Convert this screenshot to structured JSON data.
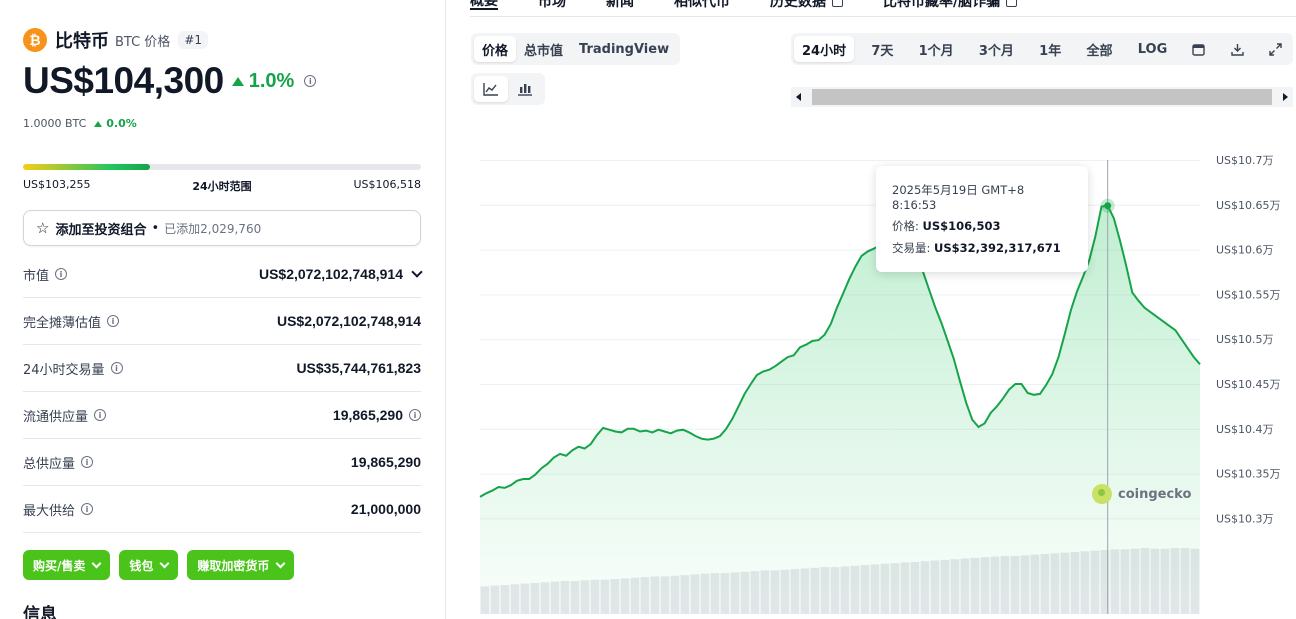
{
  "coin": {
    "logo_glyph": "₿",
    "name": "比特币",
    "subtitle": "BTC 价格",
    "rank": "#1",
    "price": "US$104,300",
    "change_24h": "1.0%",
    "price_btc": "1.0000 BTC",
    "change_btc": "0.0%",
    "colors": {
      "logo": "#f7931a",
      "up": "#16a34a",
      "action": "#4ac41a"
    }
  },
  "range": {
    "low": "US$103,255",
    "label": "24小时范围",
    "high": "US$106,518",
    "position_fraction": 0.32
  },
  "portfolio": {
    "label": "添加至投资组合",
    "separator": "•",
    "added": "已添加2,029,760"
  },
  "stats": [
    {
      "label": "市值",
      "value": "US$2,072,102,748,914"
    },
    {
      "label": "完全摊薄估值",
      "value": "US$2,072,102,748,914"
    },
    {
      "label": "24小时交易量",
      "value": "US$35,744,761,823"
    },
    {
      "label": "流通供应量",
      "value": "19,865,290"
    },
    {
      "label": "总供应量",
      "value": "19,865,290"
    },
    {
      "label": "最大供给",
      "value": "21,000,000"
    }
  ],
  "actions": [
    "购买/售卖",
    "钱包",
    "赚取加密货币"
  ],
  "info_heading": "信息",
  "top_tabs": [
    "概要",
    "市场",
    "新闻",
    "相似代币",
    "历史数据",
    "比特币藏率/脑诈骗"
  ],
  "chart_toolbar": {
    "modes": [
      "价格",
      "总市值",
      "TradingView"
    ],
    "ranges": [
      "24小时",
      "7天",
      "1个月",
      "3个月",
      "1年",
      "全部",
      "LOG"
    ],
    "icons": [
      "line-chart-icon",
      "candlestick-icon",
      "calendar-icon",
      "download-icon",
      "expand-icon"
    ]
  },
  "tooltip": {
    "date": "2025年5月19日 GMT+8 8:16:53",
    "price_label": "价格:",
    "price_value": "US$106,503",
    "volume_label": "交易量:",
    "volume_value": "US$32,392,317,671"
  },
  "watermark": "coingecko",
  "chart_data": {
    "type": "line",
    "title": "",
    "xlabel": "",
    "ylabel": "",
    "y_tick_labels": [
      "US$10.7万",
      "US$10.65万",
      "US$10.6万",
      "US$10.55万",
      "US$10.5万",
      "US$10.45万",
      "US$10.4万",
      "US$10.35万",
      "US$10.3万"
    ],
    "ylim": [
      103000,
      107000
    ],
    "grid": true,
    "series": [
      {
        "values": [
          103240,
          103280,
          103310,
          103350,
          103340,
          103370,
          103420,
          103440,
          103440,
          103490,
          103560,
          103610,
          103680,
          103720,
          103700,
          103760,
          103800,
          103780,
          103830,
          103930,
          104010,
          103990,
          103970,
          103960,
          104000,
          104000,
          103970,
          103980,
          103960,
          103990,
          103970,
          103950,
          103980,
          103990,
          103960,
          103920,
          103890,
          103880,
          103890,
          103920,
          104000,
          104110,
          104250,
          104390,
          104500,
          104600,
          104640,
          104660,
          104700,
          104750,
          104800,
          104820,
          104910,
          104940,
          104980,
          104990,
          105050,
          105170,
          105350,
          105510,
          105670,
          105810,
          105930,
          105980,
          106010,
          106050,
          106110,
          106130,
          106080,
          105980,
          105930,
          105860,
          105750,
          105550,
          105350,
          105180,
          104980,
          104780,
          104530,
          104290,
          104100,
          104020,
          104060,
          104180,
          104250,
          104340,
          104440,
          104500,
          104500,
          104400,
          104380,
          104390,
          104490,
          104610,
          104800,
          105050,
          105320,
          105530,
          105700,
          105880,
          106150,
          106480,
          106490,
          106350,
          106100,
          105820,
          105520,
          105430,
          105350,
          105300,
          105250,
          105200,
          105150,
          105100,
          105000,
          104900,
          104800,
          104720
        ],
        "volume_relative": [
          0.42,
          0.43,
          0.44,
          0.45,
          0.46,
          0.47,
          0.48,
          0.49,
          0.5,
          0.5,
          0.51,
          0.52,
          0.52,
          0.53,
          0.54,
          0.55,
          0.56,
          0.57,
          0.57,
          0.58,
          0.59,
          0.6,
          0.61,
          0.62,
          0.62,
          0.63,
          0.64,
          0.65,
          0.66,
          0.66,
          0.67,
          0.68,
          0.69,
          0.7,
          0.71,
          0.71,
          0.72,
          0.73,
          0.74,
          0.75,
          0.76,
          0.77,
          0.78,
          0.79,
          0.8,
          0.81,
          0.82,
          0.83,
          0.84,
          0.85,
          0.86,
          0.87,
          0.88,
          0.88,
          0.89,
          0.9,
          0.91,
          0.92,
          0.93,
          0.94,
          0.95,
          0.96,
          0.97,
          0.98,
          0.98,
          0.99,
          1.0,
          0.99,
          0.99,
          1.0,
          1.0,
          0.99
        ]
      }
    ],
    "hover_point": {
      "price": 106503
    }
  }
}
